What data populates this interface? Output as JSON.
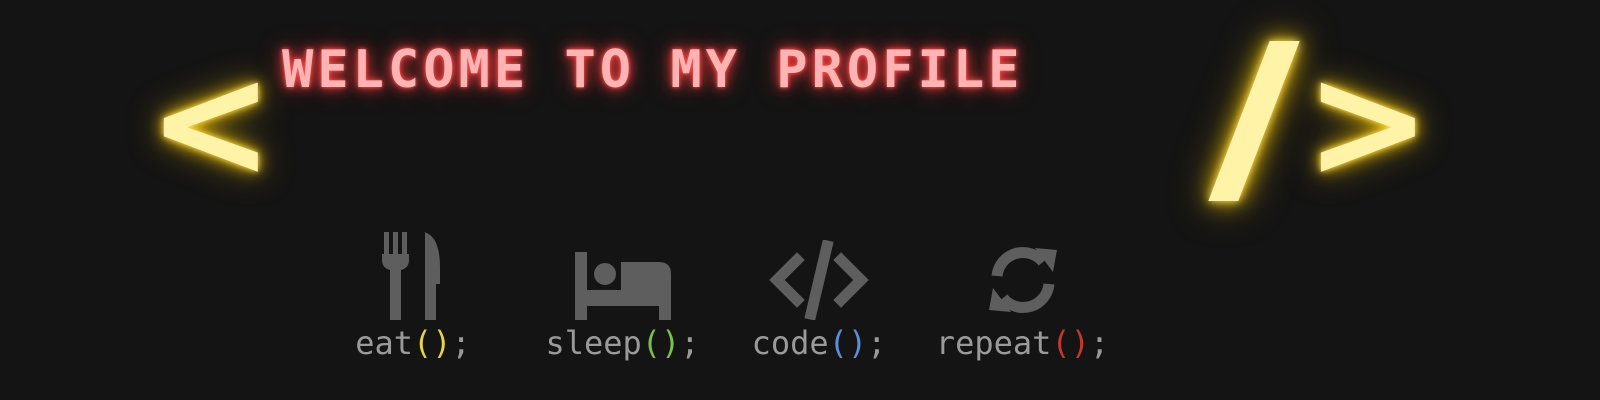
{
  "banner": {
    "title": "WELCOME TO MY PROFILE",
    "left_bracket": "<",
    "right_bracket": ">",
    "accent_yellow": "#fff3a8",
    "accent_red": "#ff3b3b"
  },
  "activities": [
    {
      "name": "eat",
      "icon": "fork-knife-icon",
      "paren_open": "(",
      "paren_close": ")",
      "suffix": ";",
      "paren_color": "#e6d14a"
    },
    {
      "name": "sleep",
      "icon": "bed-icon",
      "paren_open": "(",
      "paren_close": ")",
      "suffix": ";",
      "paren_color": "#7cbf4a"
    },
    {
      "name": "code",
      "icon": "code-icon",
      "paren_open": "(",
      "paren_close": ")",
      "suffix": ";",
      "paren_color": "#5c8fd9"
    },
    {
      "name": "repeat",
      "icon": "repeat-icon",
      "paren_open": "(",
      "paren_close": ")",
      "suffix": ";",
      "paren_color": "#c0392b"
    }
  ]
}
